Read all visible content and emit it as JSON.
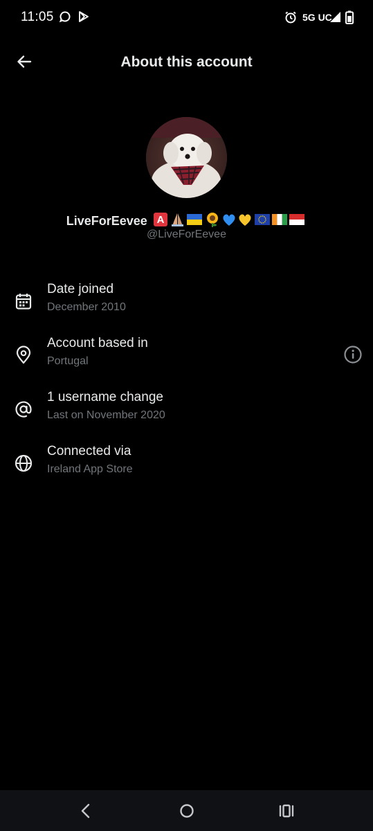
{
  "status_bar": {
    "time": "11:05",
    "network": "5G UC",
    "icons": [
      "chat-bubble-icon",
      "play-store-icon",
      "alarm-icon",
      "signal-icon",
      "battery-icon"
    ]
  },
  "header": {
    "title": "About this account",
    "back_icon": "arrow-left-icon"
  },
  "profile": {
    "display_name": "LiveForEevee",
    "display_name_emojis": [
      "🅰️",
      "🙏🏼",
      "🇺🇦",
      "🌻",
      "💙",
      "💛",
      "🇪🇺",
      "🇨🇮",
      "🇮🇩"
    ],
    "handle": "@LiveForEevee"
  },
  "info": {
    "items": [
      {
        "icon": "calendar-icon",
        "title": "Date joined",
        "subtitle": "December 2010"
      },
      {
        "icon": "location-pin-icon",
        "title": "Account based in",
        "subtitle": "Portugal",
        "info_icon": "info-circle-icon"
      },
      {
        "icon": "at-sign-icon",
        "title": "1 username change",
        "subtitle": "Last on November 2020"
      },
      {
        "icon": "globe-icon",
        "title": "Connected via",
        "subtitle": "Ireland App Store"
      }
    ]
  },
  "nav_bar": {
    "buttons": [
      "nav-back-icon",
      "nav-home-icon",
      "nav-recents-icon"
    ]
  },
  "colors": {
    "background": "#000000",
    "primary_text": "#e7e9ea",
    "secondary_text": "#71767b",
    "nav_bar": "#101114"
  }
}
